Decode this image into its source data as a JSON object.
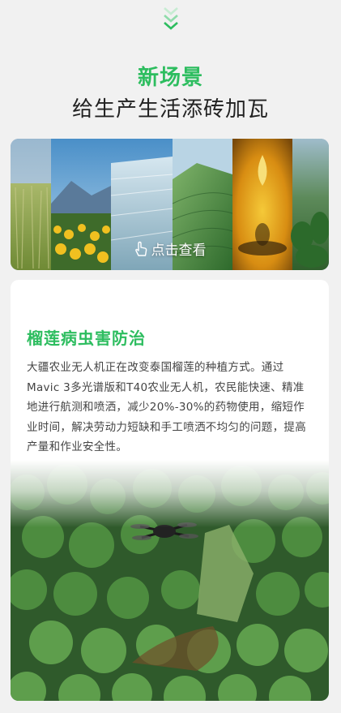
{
  "headline": {
    "line1": "新场景",
    "line2": "给生产生活添砖加瓦"
  },
  "banner": {
    "cta_label": "点击查看",
    "cta_icon": "tap-hand-icon"
  },
  "scene_card": {
    "title": "榴莲病虫害防治",
    "description": "大疆农业无人机正在改变泰国榴莲的种植方式。通过Mavic 3多光谱版和T40农业无人机，农民能快速、精准地进行航测和喷洒，减少20%-30%的药物使用，缩短作业时间，解决劳动力短缺和手工喷洒不均匀的问题，提高产量和作业安全性。"
  },
  "colors": {
    "accent": "#2dbd5f",
    "text": "#222222",
    "background": "#f1f1f1"
  },
  "icons": [
    "chevron-down-icon",
    "tap-hand-icon"
  ]
}
